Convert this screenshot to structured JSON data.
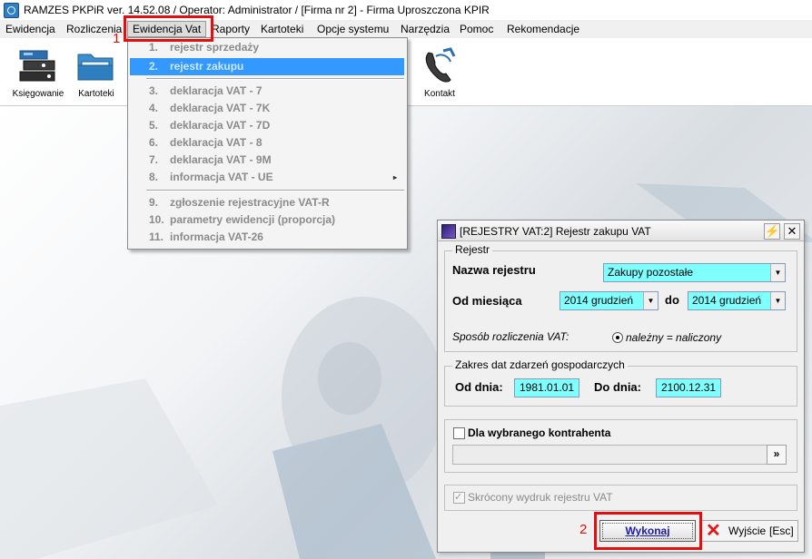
{
  "window": {
    "title": "RAMZES PKPiR ver. 14.52.08 /   Operator: Administrator /   [Firma nr 2] - Firma Uproszczona KPIR"
  },
  "menubar": {
    "items": [
      {
        "label": "Ewidencja"
      },
      {
        "label": "Rozliczenia"
      },
      {
        "label": "Ewidencja Vat"
      },
      {
        "label": "Raporty"
      },
      {
        "label": "Kartoteki"
      },
      {
        "label": "Opcje systemu"
      },
      {
        "label": "Narzędzia"
      },
      {
        "label": "Pomoc"
      },
      {
        "label": "Rekomendacje"
      }
    ]
  },
  "annotations": {
    "step1": "1",
    "step2": "2"
  },
  "toolbar": {
    "tools": [
      {
        "label": "Księgowanie",
        "icon": "ledger-stack-icon"
      },
      {
        "label": "Kartoteki",
        "icon": "folder-icon"
      },
      {
        "label": "Kontakt",
        "icon": "phone-icon"
      }
    ]
  },
  "vat_menu": {
    "items": [
      {
        "num": "1.",
        "label": "rejestr sprzedaży"
      },
      {
        "num": "2.",
        "label": "rejestr zakupu"
      },
      {
        "num": "3.",
        "label": "deklaracja VAT - 7"
      },
      {
        "num": "4.",
        "label": "deklaracja VAT - 7K"
      },
      {
        "num": "5.",
        "label": "deklaracja VAT - 7D"
      },
      {
        "num": "6.",
        "label": "deklaracja VAT - 8"
      },
      {
        "num": "7.",
        "label": "deklaracja VAT - 9M"
      },
      {
        "num": "8.",
        "label": "informacja VAT - UE"
      },
      {
        "num": "9.",
        "label": "zgłoszenie rejestracyjne VAT-R"
      },
      {
        "num": "10.",
        "label": "parametry ewidencji (proporcja)"
      },
      {
        "num": "11.",
        "label": "informacja VAT-26"
      }
    ],
    "highlighted_index": 1,
    "submenu_arrow": "▸"
  },
  "dialog": {
    "title": "[REJESTRY VAT:2]  Rejestr zakupu VAT",
    "pin_glyph": "⚡",
    "close_glyph": "✕",
    "rejestr_group": {
      "label": "Rejestr",
      "nazwa_label": "Nazwa rejestru",
      "nazwa_value": "Zakupy pozostałe",
      "od_miesiaca_label": "Od miesiąca",
      "od_miesiaca_value": "2014 grudzień",
      "do_label": "do",
      "do_value": "2014 grudzień",
      "sposob_label": "Sposób rozliczenia VAT:",
      "sposob_value": "należny = naliczony"
    },
    "zakres_group": {
      "label": "Zakres dat zdarzeń gospodarczych",
      "od_dnia_label": "Od dnia:",
      "od_dnia_value": "1981.01.01",
      "do_dnia_label": "Do dnia:",
      "do_dnia_value": "2100.12.31"
    },
    "kontrahent": {
      "label": "Dla wybranego kontrahenta",
      "checked": false,
      "browse_glyph": "»"
    },
    "skrocony": {
      "label": "Skrócony wydruk rejestru VAT",
      "checked": true
    },
    "buttons": {
      "wykonaj": "Wykonaj",
      "wyjscie": "Wyjście",
      "esc": "[Esc]"
    },
    "colors": {
      "field_bg": "#80ffff",
      "highlight": "#3399ff",
      "annotation": "#e01010"
    }
  }
}
